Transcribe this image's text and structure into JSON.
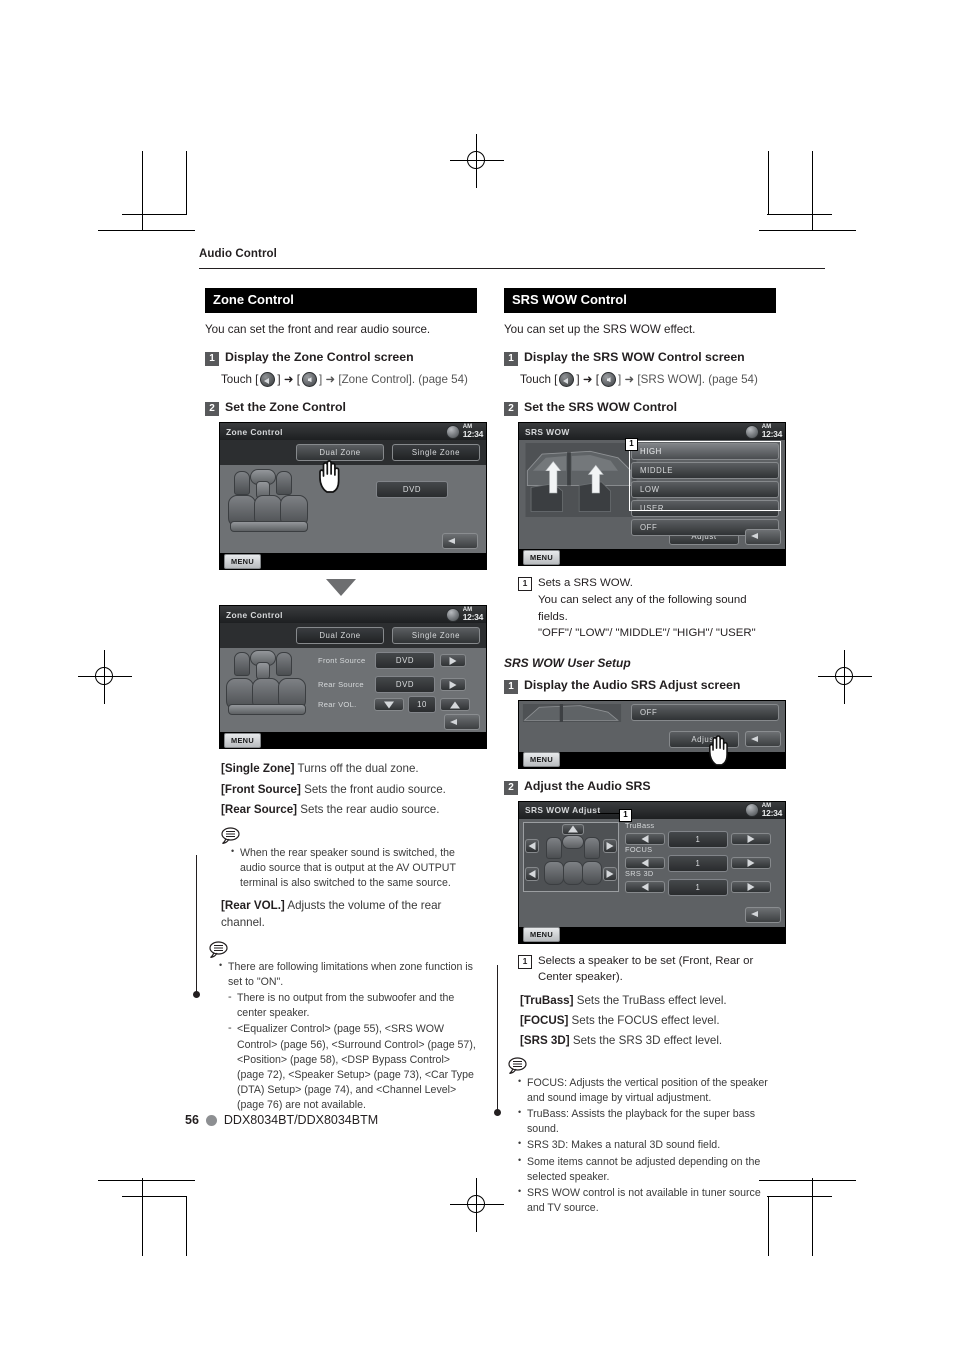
{
  "page": {
    "running_head": "Audio Control",
    "footer_page": "56",
    "footer_model": "DDX8034BT/DDX8034BTM"
  },
  "left": {
    "section_title": "Zone Control",
    "intro": "You can set the front and rear audio source.",
    "step1": {
      "num": "1",
      "text": "Display the Zone Control screen"
    },
    "touch": {
      "prefix": "Touch [",
      "mid1": "] ➜ [",
      "mid2": "] ➜ [Zone Control]. (page 54)",
      "icon1": "back-arrow-icon",
      "icon2": "sound-setup-icon"
    },
    "step2": {
      "num": "2",
      "text": "Set the Zone Control"
    },
    "screen1": {
      "title": "Zone Control",
      "clock_ampm": "AM",
      "clock_time": "12:34",
      "btn_dual": "Dual Zone",
      "btn_single": "Single Zone",
      "source": "DVD",
      "menu": "MENU"
    },
    "screen2": {
      "title": "Zone Control",
      "clock_ampm": "AM",
      "clock_time": "12:34",
      "btn_dual": "Dual Zone",
      "btn_single": "Single Zone",
      "row1_label": "Front Source",
      "row1_value": "DVD",
      "row2_label": "Rear Source",
      "row2_value": "DVD",
      "row3_label": "Rear VOL.",
      "row3_value": "10",
      "menu": "MENU"
    },
    "defs": [
      {
        "key": "[Single Zone]",
        "desc": "Turns off the dual zone."
      },
      {
        "key": "[Front Source]",
        "desc": "Sets the front audio source."
      },
      {
        "key": "[Rear Source]",
        "desc": "Sets the rear audio source."
      }
    ],
    "note1": [
      "When the rear speaker sound is switched, the audio source that is output at the AV OUTPUT terminal is also switched to the same source."
    ],
    "def_rearvol": {
      "key": "[Rear VOL.]",
      "desc": "Adjusts the volume of the rear channel."
    },
    "note2_main": "There are following limitations when zone function is set to \"ON\".",
    "note2_subs": [
      "There is no output from the subwoofer and the center speaker.",
      "<Equalizer Control> (page 55), <SRS WOW Control> (page 56), <Surround Control> (page 57), <Position> (page 58), <DSP Bypass Control> (page 72), <Speaker Setup> (page 73), <Car Type (DTA) Setup> (page 74), and <Channel Level> (page 76) are not available."
    ]
  },
  "right": {
    "section_title": "SRS WOW Control",
    "intro": "You can set up the SRS WOW effect.",
    "step1": {
      "num": "1",
      "text": "Display the SRS WOW Control screen"
    },
    "touch": {
      "prefix": "Touch [",
      "mid1": "] ➜ [",
      "mid2": "] ➜ [SRS WOW]. (page 54)",
      "icon1": "back-arrow-icon",
      "icon2": "sound-setup-icon"
    },
    "step2": {
      "num": "2",
      "text": "Set the SRS WOW Control"
    },
    "screen1": {
      "title": "SRS WOW",
      "clock_ampm": "AM",
      "clock_time": "12:34",
      "items": [
        "HIGH",
        "MIDDLE",
        "LOW",
        "USER",
        "OFF"
      ],
      "adjust": "Adjust",
      "menu": "MENU",
      "tag": "1"
    },
    "callout1": {
      "num": "1",
      "line1": "Sets a SRS WOW.",
      "line2": "You can select any of the following sound fields.",
      "line3": "\"OFF\"/ \"LOW\"/ \"MIDDLE\"/ \"HIGH\"/ \"USER\""
    },
    "subhead": "SRS WOW User Setup",
    "step3": {
      "num": "1",
      "text": "Display the Audio SRS Adjust screen"
    },
    "screen2": {
      "off": "OFF",
      "adjust": "Adjust",
      "menu": "MENU"
    },
    "step4": {
      "num": "2",
      "text": "Adjust the Audio SRS"
    },
    "screen3": {
      "title": "SRS WOW Adjust",
      "clock_ampm": "AM",
      "clock_time": "12:34",
      "tag": "1",
      "rows": [
        {
          "label": "TruBass",
          "value": "1"
        },
        {
          "label": "FOCUS",
          "value": "1"
        },
        {
          "label": "SRS 3D",
          "value": "1"
        }
      ],
      "menu": "MENU"
    },
    "callout2": {
      "num": "1",
      "text": "Selects a speaker to be set (Front, Rear or Center speaker)."
    },
    "defs": [
      {
        "key": "[TruBass]",
        "desc": "Sets the TruBass effect level."
      },
      {
        "key": "[FOCUS]",
        "desc": "Sets the FOCUS effect level."
      },
      {
        "key": "[SRS 3D]",
        "desc": "Sets the SRS 3D effect level."
      }
    ],
    "note": [
      "FOCUS: Adjusts the vertical position of the speaker and sound image by virtual adjustment.",
      "TruBass: Assists the playback for the super bass sound.",
      "SRS 3D: Makes a natural 3D sound field.",
      "Some items cannot be adjusted depending on the selected speaker.",
      "SRS WOW control is not available in tuner source and TV source."
    ]
  }
}
